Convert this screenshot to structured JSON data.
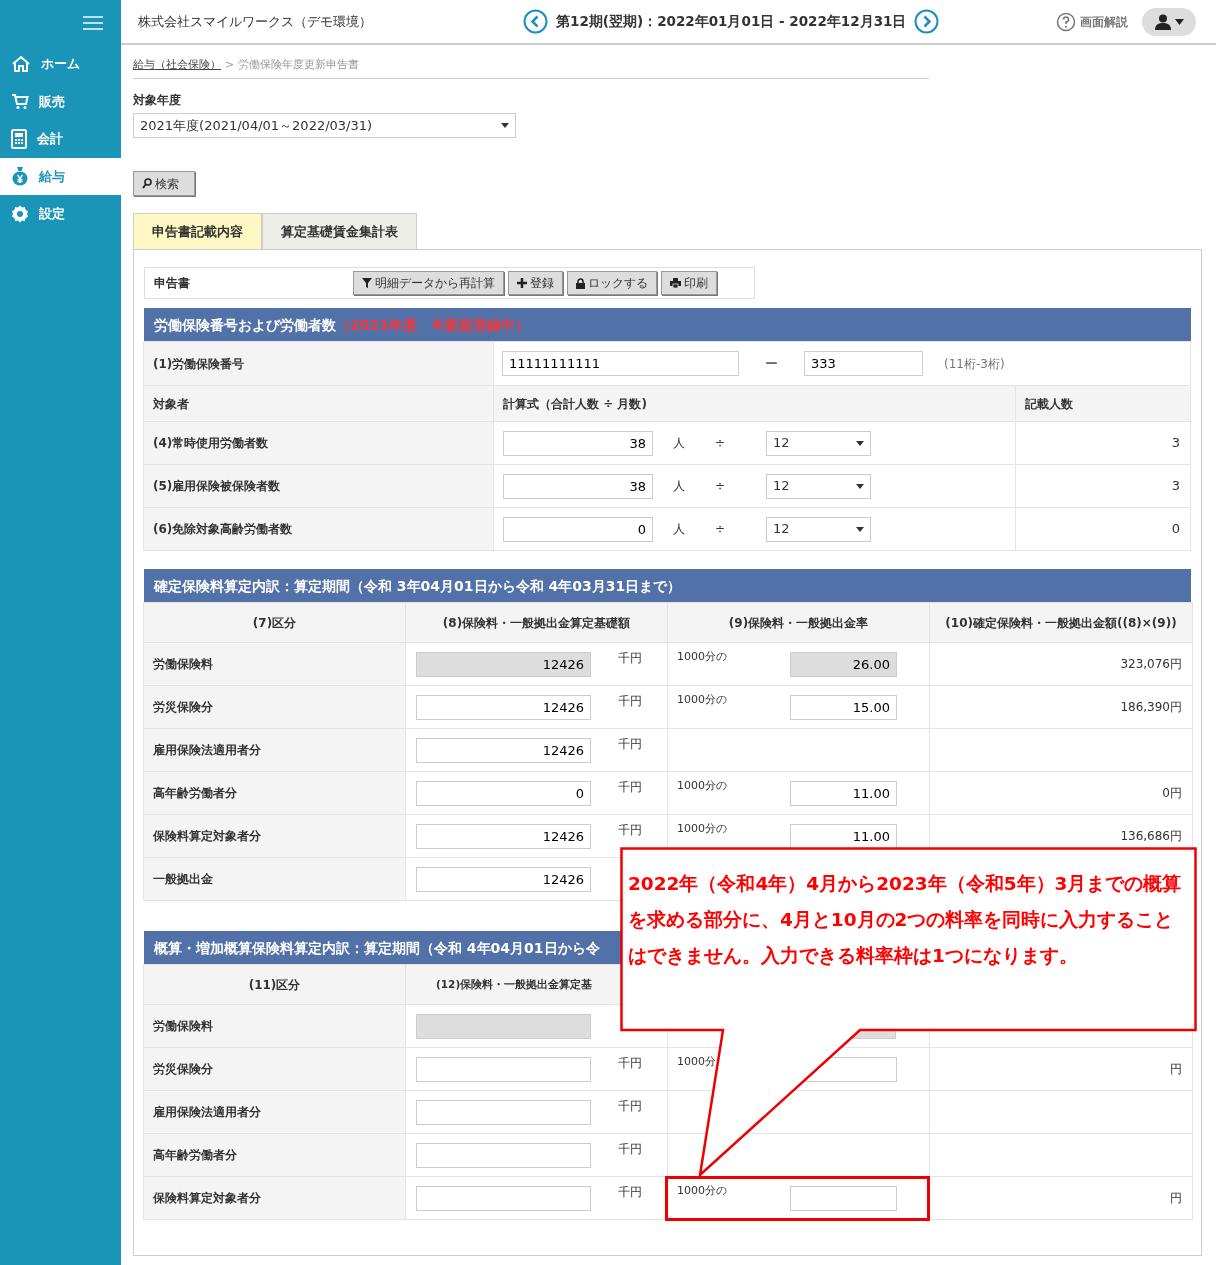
{
  "sidebar": {
    "items": [
      {
        "label": "ホーム",
        "selected": false
      },
      {
        "label": "販売",
        "selected": false
      },
      {
        "label": "会計",
        "selected": false
      },
      {
        "label": "給与",
        "selected": true
      },
      {
        "label": "設定",
        "selected": false
      }
    ]
  },
  "header": {
    "company": "株式会社スマイルワークス（デモ環境）",
    "period": "第12期(翌期)：2022年01月01日 - 2022年12月31日",
    "help": "画面解説"
  },
  "breadcrumb": {
    "items": [
      {
        "label": "給与（社会保険）",
        "link": true
      },
      {
        "label": "労働保険年度更新申告書",
        "link": false
      }
    ],
    "separator": ">"
  },
  "year_field": {
    "label": "対象年度",
    "value": "2021年度(2021/04/01～2022/03/31)"
  },
  "search_button": "検索",
  "tabs": [
    {
      "label": "申告書記載内容",
      "selected": true
    },
    {
      "label": "算定基礎賃金集計表",
      "selected": false
    }
  ],
  "toolbar": {
    "label": "申告書",
    "buttons": [
      {
        "label": "明細データから再計算"
      },
      {
        "label": "登録"
      },
      {
        "label": "ロックする"
      },
      {
        "label": "印刷"
      }
    ]
  },
  "section1": {
    "title": "労働保険番号および労働者数",
    "note": "（2021年度　※新規登録中）",
    "insurance_number": {
      "label": "(1)労働保険番号",
      "part1": "11111111111",
      "dash": "ー",
      "part2": "333",
      "hint": "(11桁-3桁)"
    },
    "columns": [
      "対象者",
      "計算式（合計人数 ÷ 月数)",
      "記載人数"
    ],
    "rows": [
      {
        "label": "(4)常時使用労働者数",
        "count": "38",
        "unit": "人",
        "divide": "÷",
        "months": "12",
        "result": "3"
      },
      {
        "label": "(5)雇用保険被保険者数",
        "count": "38",
        "unit": "人",
        "divide": "÷",
        "months": "12",
        "result": "3"
      },
      {
        "label": "(6)免除対象高齢労働者数",
        "count": "0",
        "unit": "人",
        "divide": "÷",
        "months": "12",
        "result": "0"
      }
    ]
  },
  "section2": {
    "title": "確定保険料算定内訳：算定期間（令和 3年04月01日から令和 4年03月31日まで）",
    "columns": [
      "(7)区分",
      "(8)保険料・一般拠出金算定基礎額",
      "(9)保険料・一般拠出金率",
      "(10)確定保険料・一般拠出金額((8)×(9))"
    ],
    "rows": [
      {
        "label": "労働保険料",
        "base": "12426",
        "unit": "千円",
        "readonly": true,
        "rate_prefix": "1000分の",
        "rate": "26.00",
        "amount": "323,076円",
        "highlighted": false
      },
      {
        "label": "労災保険分",
        "base": "12426",
        "unit": "千円",
        "readonly": false,
        "rate_prefix": "1000分の",
        "rate": "15.00",
        "amount": "186,390円",
        "highlighted": false
      },
      {
        "label": "雇用保険法適用者分",
        "base": "12426",
        "unit": "千円",
        "readonly": false,
        "highlighted": false
      },
      {
        "label": "高年齢労働者分",
        "base": "0",
        "unit": "千円",
        "readonly": false,
        "rate_prefix": "1000分の",
        "rate": "11.00",
        "amount": "0円",
        "highlighted": false
      },
      {
        "label": "保険料算定対象者分",
        "base": "12426",
        "unit": "千円",
        "readonly": false,
        "rate_prefix": "1000分の",
        "rate": "11.00",
        "amount": "136,686円",
        "highlighted": false
      },
      {
        "label": "一般拠出金",
        "base": "12426",
        "readonly": false,
        "highlighted": false
      }
    ]
  },
  "section3": {
    "title": "概算・増加概算保険料算定内訳：算定期間（令和 4年04月01日から令",
    "columns": [
      "(11)区分",
      "(12)保険料・一般拠出金算定基"
    ],
    "rows": [
      {
        "label": "労働保険料",
        "readonly": true,
        "rate_field": true,
        "highlighted": false
      },
      {
        "label": "労災保険分",
        "unit": "千円",
        "readonly": false,
        "rate_prefix": "1000分",
        "rate_field": true,
        "amount": "円",
        "highlighted": false
      },
      {
        "label": "雇用保険法適用者分",
        "unit": "千円",
        "readonly": false,
        "rate_field": false,
        "highlighted": false
      },
      {
        "label": "高年齢労働者分",
        "unit": "千円",
        "readonly": false,
        "rate_field": false,
        "highlighted": false
      },
      {
        "label": "保険料算定対象者分",
        "unit": "千円",
        "readonly": false,
        "rate_prefix": "1000分の",
        "rate_field": true,
        "amount": "円",
        "highlighted": true
      }
    ]
  },
  "callout": {
    "text": "2022年（令和4年）4月から2023年（令和5年）3月までの概算を求める部分に、4月と10月の2つの料率を同時に入力することはできません。入力できる料率枠は1つになります。"
  }
}
